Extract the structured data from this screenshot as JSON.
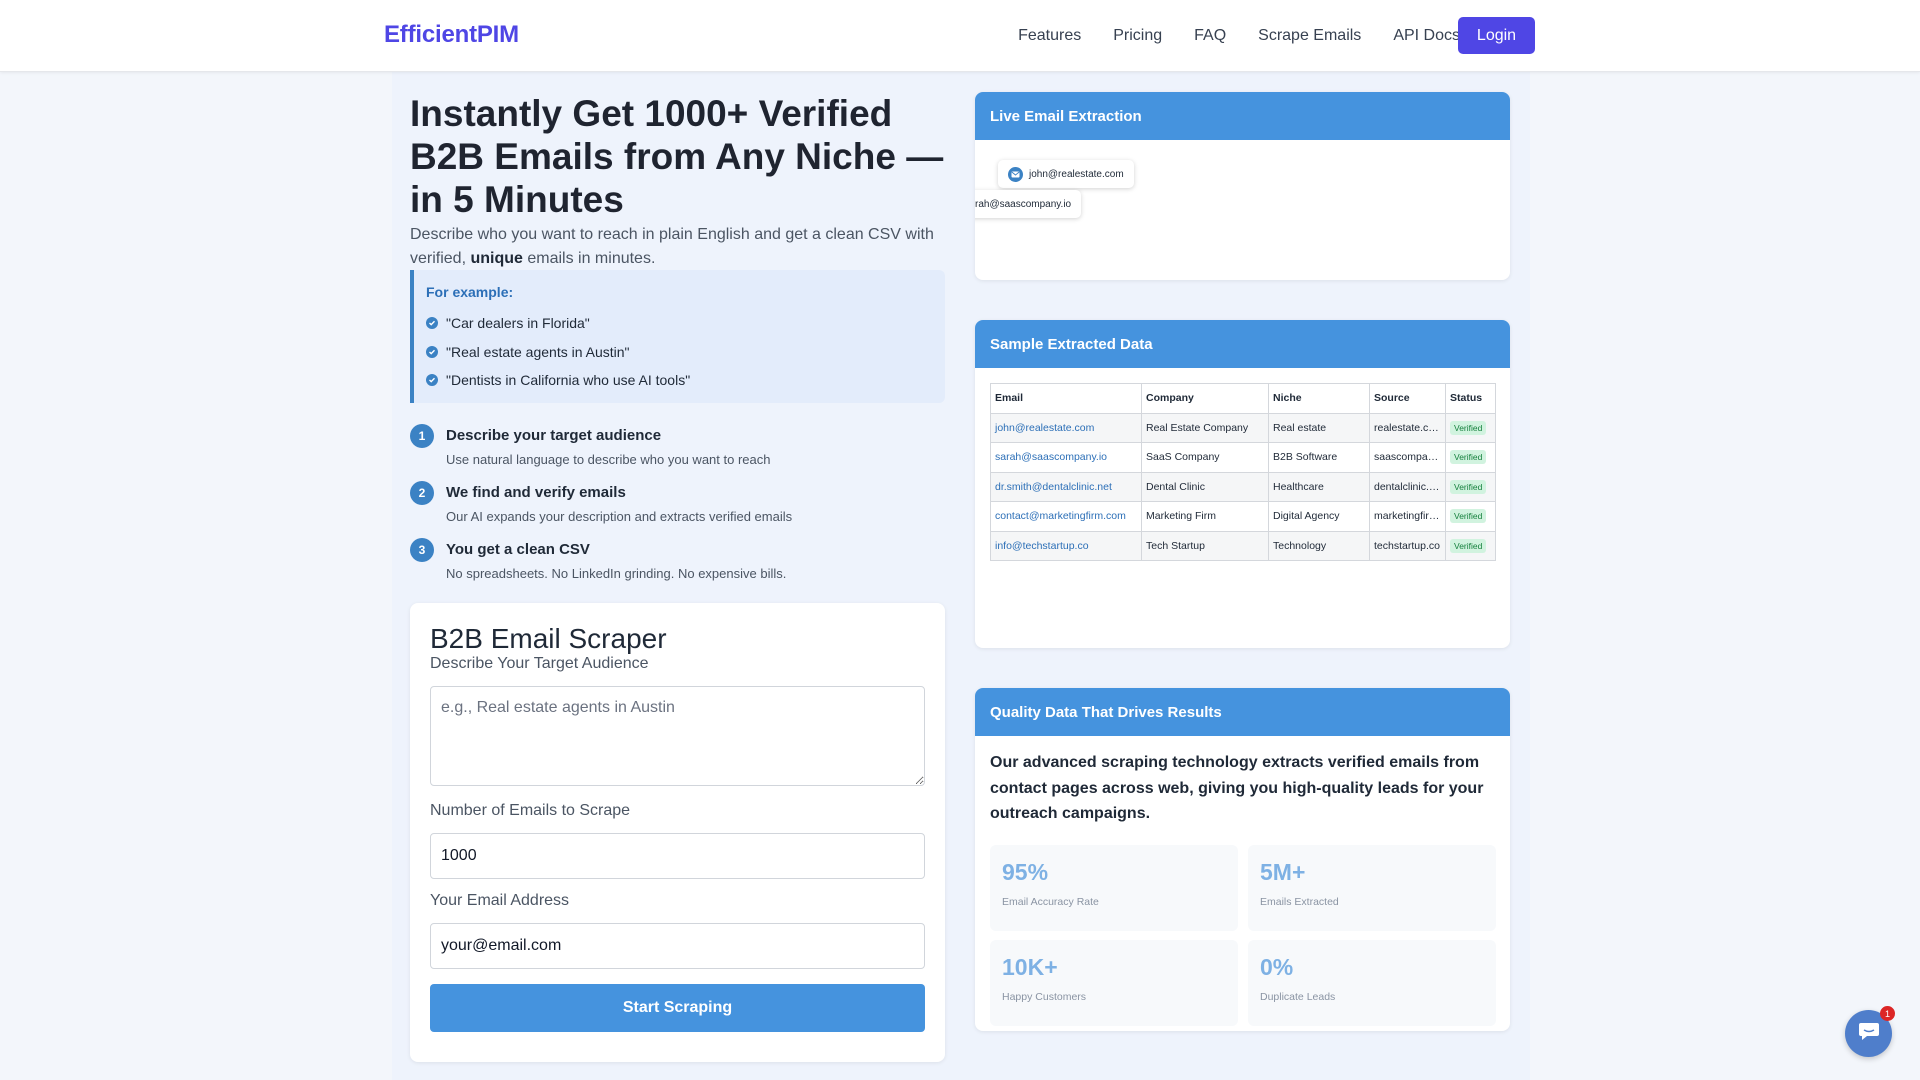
{
  "nav": {
    "brand": "EfficientPIM",
    "links": [
      "Features",
      "Pricing",
      "FAQ",
      "Scrape Emails",
      "API Docs"
    ],
    "login": "Login"
  },
  "hero": {
    "title": "Instantly Get 1000+ Verified B2B Emails from Any Niche — in 5 Minutes",
    "subtitle_before": "Describe who you want to reach in plain English and get a clean CSV with verified, ",
    "subtitle_bold": "unique",
    "subtitle_after": " emails in minutes."
  },
  "examples": {
    "title": "For example:",
    "items": [
      "\"Car dealers in Florida\"",
      "\"Real estate agents in Austin\"",
      "\"Dentists in California who use AI tools\""
    ]
  },
  "steps": [
    {
      "num": "1",
      "title": "Describe your target audience",
      "desc": "Use natural language to describe who you want to reach"
    },
    {
      "num": "2",
      "title": "We find and verify emails",
      "desc": "Our AI expands your description and extracts verified emails"
    },
    {
      "num": "3",
      "title": "You get a clean CSV",
      "desc": "No spreadsheets. No LinkedIn grinding. No expensive bills."
    }
  ],
  "form": {
    "title": "B2B Email Scraper",
    "audience_label": "Describe Your Target Audience",
    "audience_placeholder": "e.g., Real estate agents in Austin",
    "count_label": "Number of Emails to Scrape",
    "count_value": "1000",
    "email_label": "Your Email Address",
    "email_value": "your@email.com",
    "submit": "Start Scraping"
  },
  "live": {
    "title": "Live Email Extraction",
    "chips": [
      "john@realestate.com",
      "rah@saascompany.io"
    ]
  },
  "sample": {
    "title": "Sample Extracted Data",
    "headers": [
      "Email",
      "Company",
      "Niche",
      "Source",
      "Status"
    ],
    "rows": [
      [
        "john@realestate.com",
        "Real Estate Company",
        "Real estate",
        "realestate.com",
        "Verified"
      ],
      [
        "sarah@saascompany.io",
        "SaaS Company",
        "B2B Software",
        "saascompany.io",
        "Verified"
      ],
      [
        "dr.smith@dentalclinic.net",
        "Dental Clinic",
        "Healthcare",
        "dentalclinic.net",
        "Verified"
      ],
      [
        "contact@marketingfirm.com",
        "Marketing Firm",
        "Digital Agency",
        "marketingfirm.com",
        "Verified"
      ],
      [
        "info@techstartup.co",
        "Tech Startup",
        "Technology",
        "techstartup.co",
        "Verified"
      ]
    ]
  },
  "quality": {
    "title": "Quality Data That Drives Results",
    "text": "Our advanced scraping technology extracts verified emails from contact pages across web, giving you high-quality leads for your outreach campaigns.",
    "stats": [
      {
        "value": "95%",
        "label": "Email Accuracy Rate"
      },
      {
        "value": "5M+",
        "label": "Emails Extracted"
      },
      {
        "value": "10K+",
        "label": "Happy Customers"
      },
      {
        "value": "0%",
        "label": "Duplicate Leads"
      }
    ]
  },
  "chat": {
    "badge": "1"
  },
  "colors": {
    "brand": "#4f46e5",
    "accent": "#4593de",
    "verified_bg": "#d1f3df"
  }
}
